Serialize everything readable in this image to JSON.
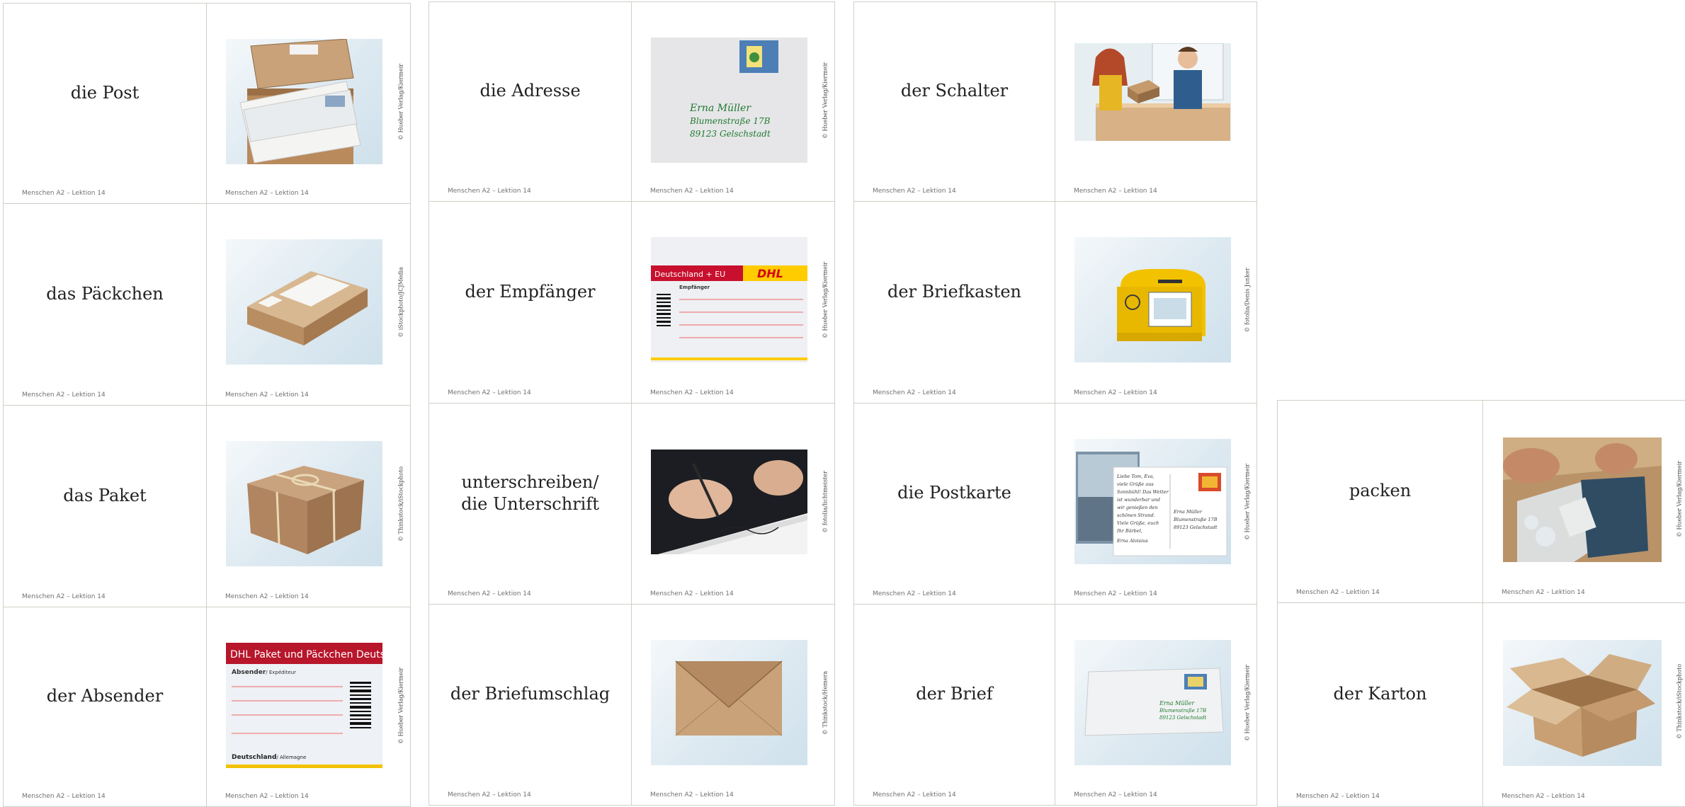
{
  "footer_text": "Menschen A2 – Lektion 14",
  "cards": [
    {
      "word": "die Post",
      "credit": "© Hueber Verlag/Kiermeir",
      "icon": "mail-stack-icon"
    },
    {
      "word": "das Päckchen",
      "credit": "© iStockphoto/JCJMedia",
      "icon": "small-parcel-icon"
    },
    {
      "word": "das Paket",
      "credit": "© Thinkstock/iStockphoto",
      "icon": "parcel-icon"
    },
    {
      "word": "der Absender",
      "credit": "© Hueber Verlag/Kiermeir",
      "icon": "sender-label-icon"
    },
    {
      "word": "die Adresse",
      "credit": "© Hueber Verlag/Kiermeir",
      "icon": "addressed-envelope-icon"
    },
    {
      "word": "der Empfänger",
      "credit": "© Hueber Verlag/Kiermeir",
      "icon": "recipient-label-icon"
    },
    {
      "word": "unterschreiben/\ndie Unterschrift",
      "credit": "© fotolia/lichtmeister",
      "icon": "signing-icon"
    },
    {
      "word": "der Briefumschlag",
      "credit": "© Thinkstock/Hemera",
      "icon": "envelope-icon"
    },
    {
      "word": "der Schalter",
      "credit": "",
      "icon": "post-counter-icon"
    },
    {
      "word": "der Briefkasten",
      "credit": "© fotolia/Denis Junker",
      "icon": "mailbox-icon"
    },
    {
      "word": "die Postkarte",
      "credit": "© Hueber Verlag/Kiermeir",
      "icon": "postcard-icon"
    },
    {
      "word": "der Brief",
      "credit": "© Hueber Verlag/Kiermeir",
      "icon": "letter-icon"
    },
    {
      "word": "packen",
      "credit": "© Hueber Verlag/Kiermeir",
      "icon": "packing-icon"
    },
    {
      "word": "der Karton",
      "credit": "© Thinkstock/iStockphoto",
      "icon": "open-box-icon"
    }
  ],
  "image_text": {
    "address_lines": [
      "Erna Müller",
      "Blumenstraße 17B",
      "89123 Gelschstadt"
    ],
    "dhl_recipient_header": "Deutschland + EU",
    "dhl_logo": "DHL",
    "dhl_recipient_field": "Empfänger",
    "dhl_sender_header": "DHL Paket und Päckchen Deutsch",
    "dhl_sender_field": "Absender",
    "dhl_sender_field_sub": "/ Expéditeur",
    "dhl_sender_country": "Deutschland",
    "dhl_sender_country_sub": "/ Allemagne",
    "postcard_lines": [
      "Liebe Tom, Eva,",
      "viele Grüße aus",
      "Sonnbühl! Das Wetter",
      "ist wunderbar und",
      "wir genießen den",
      "schönen Strand.",
      "Viele Grüße, euch",
      "Ihr Bärbel,",
      "Erna Aloisius"
    ],
    "postcard_address": [
      "Erna Müller",
      "Blumenstraße 17B",
      "89123 Gelschstadt"
    ]
  }
}
